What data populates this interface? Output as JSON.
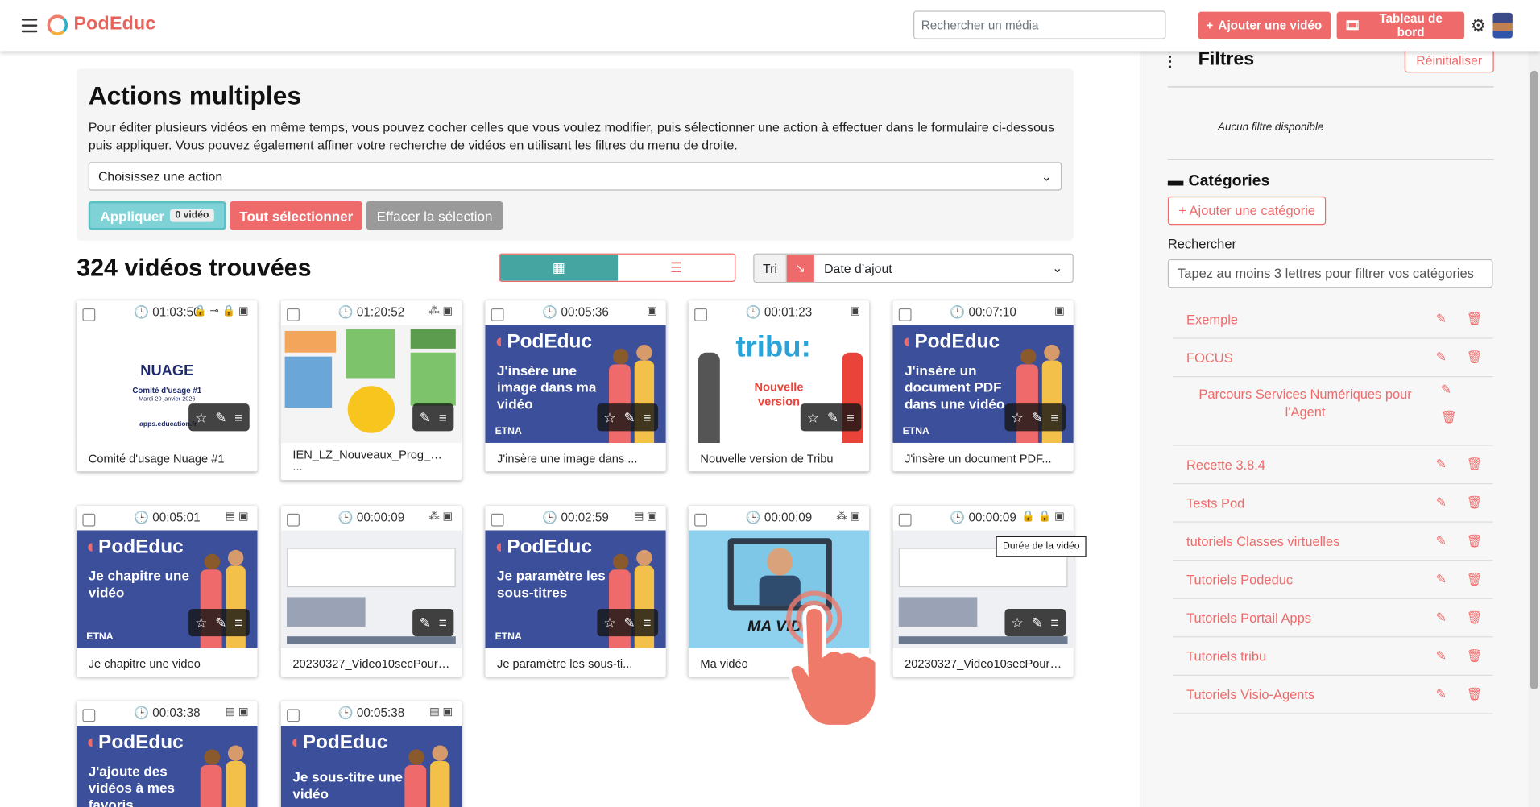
{
  "header": {
    "app_name": "PodEduc",
    "search_placeholder": "Rechercher un média",
    "add_video_label": "Ajouter une vidéo",
    "dashboard_label": "Tableau de bord"
  },
  "actions": {
    "title": "Actions multiples",
    "description": "Pour éditer plusieurs vidéos en même temps, vous pouvez cocher celles que vous voulez modifier, puis sélectionner une action à effectuer dans le formulaire ci-dessous puis appliquer. Vous pouvez également affiner votre recherche de vidéos en utilisant les filtres du menu de droite.",
    "select_placeholder": "Choisissez une action",
    "apply_label": "Appliquer",
    "apply_count": "0 vidéo",
    "select_all_label": "Tout sélectionner",
    "clear_label": "Effacer la sélection"
  },
  "results": {
    "count_label": "324 vidéos trouvées",
    "sort_label": "Tri",
    "sort_value": "Date d’ajout"
  },
  "videos": [
    {
      "duration": "01:03:50",
      "title": "Comité d'usage Nuage #1",
      "thumb_text": "NUAGE",
      "thumb_sub": "Comité d'usage #1",
      "thumb_date": "Mardi 20 janvier 2026",
      "thumb_footer": "apps.education.fr"
    },
    {
      "duration": "01:20:52",
      "title": "IEN_LZ_Nouveaux_Prog_Cyc ..."
    },
    {
      "duration": "00:05:36",
      "title": "J'insère une image dans ...",
      "thumb_text": "J'insère une image dans ma vidéo"
    },
    {
      "duration": "00:01:23",
      "title": "Nouvelle version de Tribu",
      "thumb_text": "Nouvelle version",
      "thumb_logo": "tribu:"
    },
    {
      "duration": "00:07:10",
      "title": "J'insère un document PDF...",
      "thumb_text": "J'insère un document PDF dans une vidéo"
    },
    {
      "duration": "00:05:01",
      "title": "Je chapitre une video",
      "thumb_text": "Je chapitre une vidéo"
    },
    {
      "duration": "00:00:09",
      "title": "20230327_Video10secPourT..."
    },
    {
      "duration": "00:02:59",
      "title": "Je paramètre les sous-ti...",
      "thumb_text": "Je paramètre les sous-titres"
    },
    {
      "duration": "00:00:09",
      "title": "Ma vidéo",
      "thumb_text": "MA VIDÉO"
    },
    {
      "duration": "00:00:09",
      "title": "20230327_Video10secPourT..."
    },
    {
      "duration": "00:03:38",
      "title": "",
      "thumb_text": "J'ajoute des vidéos à mes favoris"
    },
    {
      "duration": "00:05:38",
      "title": "",
      "thumb_text": "Je sous-titre une vidéo"
    }
  ],
  "tooltip": "Durée de la vidéo",
  "sidebar": {
    "filters_title": "Filtres",
    "reset_label": "Réinitialiser",
    "no_filter": "Aucun filtre disponible",
    "categories_title": "Catégories",
    "add_category_label": "+ Ajouter une catégorie",
    "search_label": "Rechercher",
    "search_placeholder": "Tapez au moins 3 lettres pour filtrer vos catégories",
    "categories": [
      "Exemple",
      "FOCUS",
      "Parcours Services Numériques pour l'Agent",
      "Recette 3.8.4",
      "Tests Pod",
      "tutoriels Classes virtuelles",
      "Tutoriels Podeduc",
      "Tutoriels Portail Apps",
      "Tutoriels tribu",
      "Tutoriels Visio-Agents"
    ]
  },
  "colors": {
    "brand": "#ef6b6b",
    "teal": "#45a6a1",
    "blue_thumb": "#3c4f9b"
  },
  "icons": [
    "menu-icon",
    "search-icon",
    "plus-icon",
    "film-icon",
    "gear-icon",
    "clock-icon",
    "lock-icon",
    "key-icon",
    "star-icon",
    "edit-icon",
    "menu-lines-icon",
    "grid-icon",
    "list-icon",
    "sort-desc-icon",
    "sliders-icon",
    "folder-icon",
    "trash-icon",
    "hand-pointer-icon"
  ]
}
